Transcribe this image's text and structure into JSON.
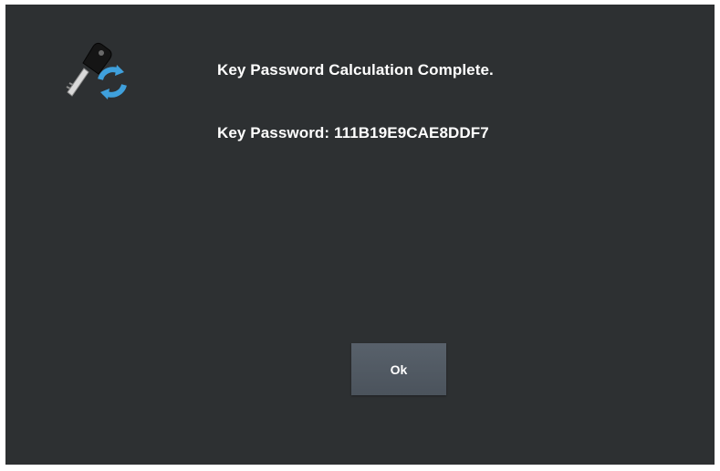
{
  "dialog": {
    "title": "Key Password Calculation Complete.",
    "password_text": "Key Password: 111B19E9CAE8DDF7",
    "ok_label": "Ok"
  },
  "icons": {
    "main": "key-refresh-icon"
  },
  "colors": {
    "background": "#2d3032",
    "text": "#ffffff",
    "button": "#535b64",
    "refresh_accent": "#3fa0dc"
  }
}
